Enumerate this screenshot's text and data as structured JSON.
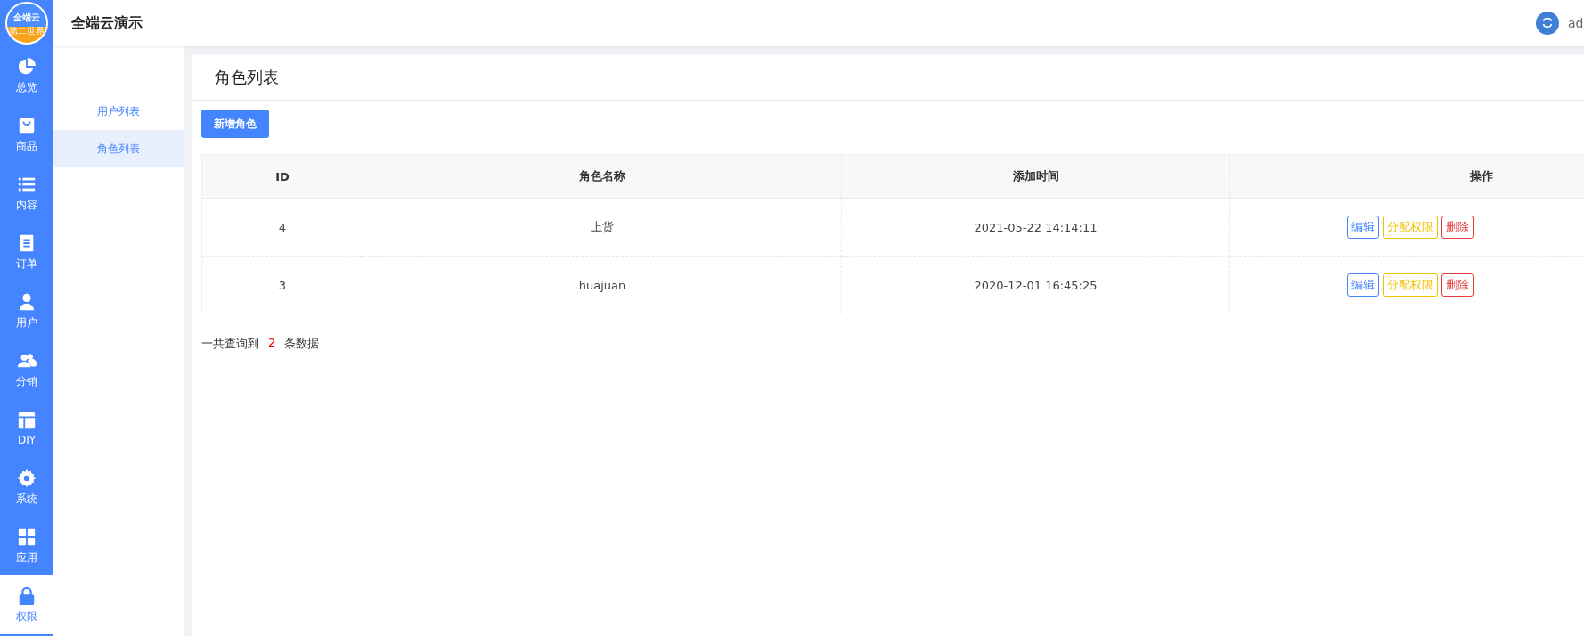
{
  "logo": {
    "text_top": "全端云",
    "text_bottom": "第二世界"
  },
  "rail": [
    {
      "label": "总览",
      "kind": "pie",
      "selected": false
    },
    {
      "label": "商品",
      "kind": "bag",
      "selected": false
    },
    {
      "label": "内容",
      "kind": "list",
      "selected": false
    },
    {
      "label": "订单",
      "kind": "doc",
      "selected": false
    },
    {
      "label": "用户",
      "kind": "user",
      "selected": false
    },
    {
      "label": "分销",
      "kind": "users",
      "selected": false
    },
    {
      "label": "DIY",
      "kind": "layout",
      "selected": false
    },
    {
      "label": "系统",
      "kind": "gear",
      "selected": false
    },
    {
      "label": "应用",
      "kind": "grid",
      "selected": false
    },
    {
      "label": "权限",
      "kind": "lock",
      "selected": true
    }
  ],
  "header": {
    "title": "全端云演示",
    "user": "ad"
  },
  "subnav": [
    {
      "label": "用户列表",
      "selected": false
    },
    {
      "label": "角色列表",
      "selected": true
    }
  ],
  "page_title": "角色列表",
  "add_button": "新增角色",
  "table": {
    "columns": [
      "ID",
      "角色名称",
      "添加时间",
      "操作"
    ],
    "rows": [
      {
        "id": "4",
        "name": "上货",
        "time": "2021-05-22 14:14:11",
        "actions": [
          {
            "label": "编辑",
            "kind": "edit"
          },
          {
            "label": "分配权限",
            "kind": "assign"
          },
          {
            "label": "删除",
            "kind": "delete"
          }
        ]
      },
      {
        "id": "3",
        "name": "huajuan",
        "time": "2020-12-01 16:45:25",
        "actions": [
          {
            "label": "编辑",
            "kind": "edit"
          },
          {
            "label": "分配权限",
            "kind": "assign"
          },
          {
            "label": "删除",
            "kind": "delete"
          }
        ]
      }
    ]
  },
  "summary": {
    "prefix": "一共查询到",
    "count": "2",
    "suffix": "条数据"
  }
}
